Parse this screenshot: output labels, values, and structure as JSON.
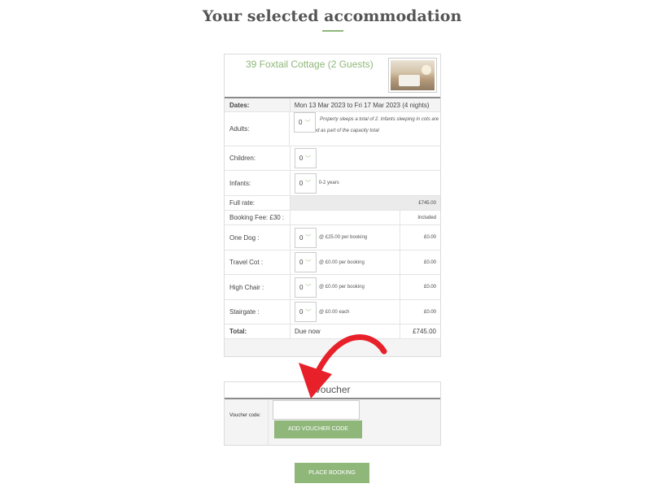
{
  "page": {
    "title": "Your selected accommodation"
  },
  "property": {
    "name": "39 Foxtail Cottage (2 Guests)"
  },
  "booking": {
    "rows": {
      "dates": {
        "label": "Dates:",
        "value": "Mon 13 Mar 2023 to Fri 17 Mar 2023 (4 nights)"
      },
      "adults": {
        "label": "Adults:",
        "select": "0",
        "note": "Property sleeps a total of 2. Infants sleeping in cots are not counted as part of the capacity total"
      },
      "children": {
        "label": "Children:",
        "select": "0"
      },
      "infants": {
        "label": "Infants:",
        "select": "0",
        "note": "0-2 years"
      },
      "full_rate": {
        "label": "Full rate:",
        "price": "£745.00"
      },
      "booking_fee": {
        "label": "Booking Fee: £30 :",
        "price": "Included"
      },
      "one_dog": {
        "label": "One Dog :",
        "select": "0",
        "note": "@ £25.00 per booking",
        "price": "£0.00"
      },
      "travel_cot": {
        "label": "Travel Cot :",
        "select": "0",
        "note": "@ £0.00 per booking",
        "price": "£0.00"
      },
      "high_chair": {
        "label": "High Chair :",
        "select": "0",
        "note": "@ £0.00 per booking",
        "price": "£0.00"
      },
      "stairgate": {
        "label": "Stairgate :",
        "select": "0",
        "note": "@ £0.00 each",
        "price": "£0.00"
      },
      "total": {
        "label": "Total:",
        "middle": "Due now",
        "price": "£745.00"
      }
    }
  },
  "voucher": {
    "heading": "Voucher",
    "label": "Voucher code:",
    "input_value": "",
    "button": "ADD VOUCHER CODE"
  },
  "actions": {
    "place_booking": "PLACE BOOKING"
  },
  "colors": {
    "accent": "#8fb77a",
    "arrow": "#e8202a"
  },
  "icons": {
    "chevron": "chevron-down-icon"
  }
}
